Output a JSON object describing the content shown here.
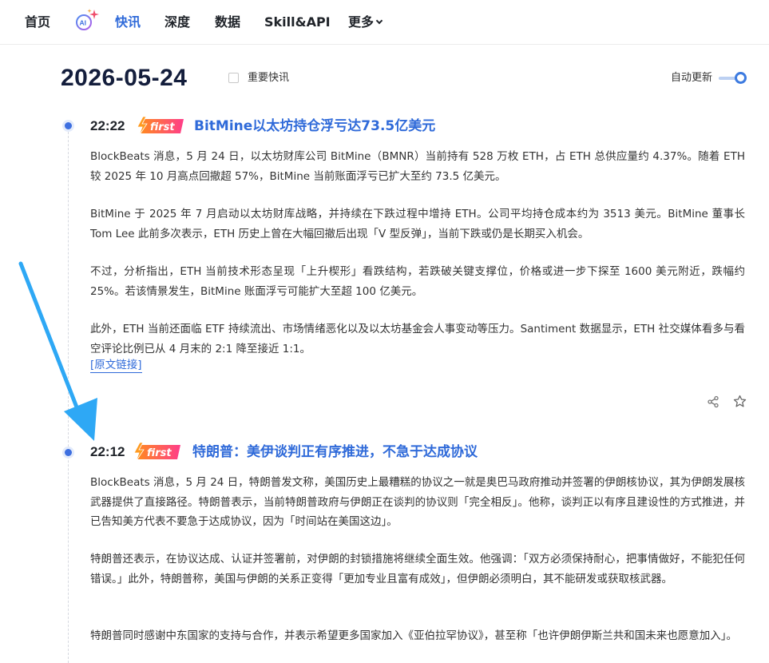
{
  "nav": {
    "home": "首页",
    "flash": "快讯",
    "depth": "深度",
    "data": "数据",
    "skill": "Skill&API",
    "more": "更多"
  },
  "header": {
    "date": "2026-05-24",
    "important_label": "重要快讯",
    "auto_update_label": "自动更新"
  },
  "colors": {
    "accent": "#2f6ad9",
    "badge_start": "#ff8a1f",
    "badge_end": "#ff3d8a",
    "arrow": "#2ea8f5"
  },
  "icons": [
    "ai-logo-icon",
    "chevron-down-icon",
    "lightning-icon",
    "share-icon",
    "star-icon",
    "annotation-arrow"
  ],
  "news": [
    {
      "time": "22:22",
      "badge": "first",
      "title": "BitMine以太坊持仓浮亏达73.5亿美元",
      "paragraphs": [
        "BlockBeats 消息，5 月 24 日，以太坊财库公司 BitMine（BMNR）当前持有 528 万枚 ETH，占 ETH 总供应量约 4.37%。随着 ETH 较 2025 年 10 月高点回撤超 57%，BitMine 当前账面浮亏已扩大至约 73.5 亿美元。",
        "BitMine 于 2025 年 7 月启动以太坊财库战略，并持续在下跌过程中增持 ETH。公司平均持仓成本约为 3513 美元。BitMine 董事长 Tom Lee 此前多次表示，ETH 历史上曾在大幅回撤后出现「V 型反弹」，当前下跌或仍是长期买入机会。",
        "不过，分析指出，ETH 当前技术形态呈现「上升楔形」看跌结构，若跌破关键支撑位，价格或进一步下探至 1600 美元附近，跌幅约 25%。若该情景发生，BitMine 账面浮亏可能扩大至超 100 亿美元。",
        "此外，ETH 当前还面临 ETF 持续流出、市场情绪恶化以及以太坊基金会人事变动等压力。Santiment 数据显示，ETH 社交媒体看多与看空评论比例已从 4 月末的 2:1 降至接近 1:1。"
      ],
      "source_link": "[原文链接]"
    },
    {
      "time": "22:12",
      "badge": "first",
      "title": "特朗普：美伊谈判正有序推进，不急于达成协议",
      "paragraphs": [
        "BlockBeats 消息，5 月 24 日，特朗普发文称，美国历史上最糟糕的协议之一就是奥巴马政府推动并签署的伊朗核协议，其为伊朗发展核武器提供了直接路径。特朗普表示，当前特朗普政府与伊朗正在谈判的协议则「完全相反」。他称，谈判正以有序且建设性的方式推进，并已告知美方代表不要急于达成协议，因为「时间站在美国这边」。",
        "特朗普还表示，在协议达成、认证并签署前，对伊朗的封锁措施将继续全面生效。他强调：「双方必须保持耐心，把事情做好，不能犯任何错误。」此外，特朗普称，美国与伊朗的关系正变得「更加专业且富有成效」，但伊朗必须明白，其不能研发或获取核武器。",
        "特朗普同时感谢中东国家的支持与合作，并表示希望更多国家加入《亚伯拉罕协议》，甚至称「也许伊朗伊斯兰共和国未来也愿意加入」。"
      ]
    }
  ]
}
